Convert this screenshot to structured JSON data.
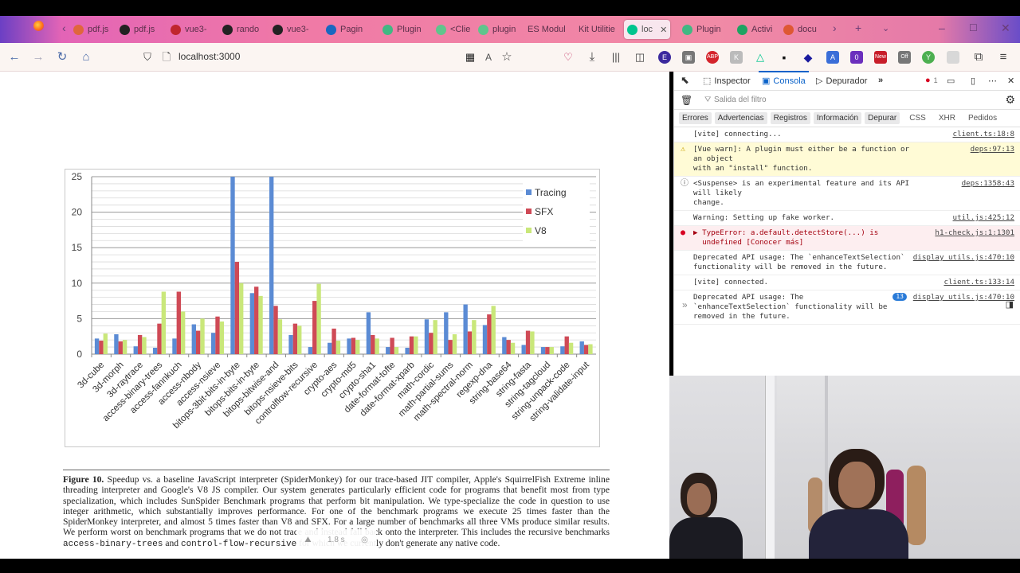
{
  "browser": {
    "tabs": [
      {
        "label": "pdf.js",
        "icon": "firefox-back-icon",
        "color": "#e0663c"
      },
      {
        "label": "pdf.js",
        "icon": "github-icon",
        "color": "#222"
      },
      {
        "label": "vue3-",
        "icon": "red-square-icon",
        "color": "#c0262d"
      },
      {
        "label": "rando",
        "icon": "github-icon",
        "color": "#222"
      },
      {
        "label": "vue3-",
        "icon": "github-icon",
        "color": "#222"
      },
      {
        "label": "Pagin",
        "icon": "vuetify-icon",
        "color": "#1867c0"
      },
      {
        "label": "Plugin",
        "icon": "vue-icon",
        "color": "#41b883"
      },
      {
        "label": "<Clie",
        "icon": "nuxt-icon",
        "color": "#5fc58c"
      },
      {
        "label": "plugin",
        "icon": "nuxt-icon",
        "color": "#5fc58c"
      },
      {
        "label": "ES Modul",
        "icon": "",
        "color": ""
      },
      {
        "label": "Kit Utilitie",
        "icon": "",
        "color": ""
      },
      {
        "label": "loc",
        "icon": "nuxt-icon",
        "color": "#00c58e",
        "active": true
      },
      {
        "label": "Plugin",
        "icon": "vue-icon",
        "color": "#41b883"
      },
      {
        "label": "Activi",
        "icon": "sheets-icon",
        "color": "#1ea362"
      },
      {
        "label": "docu",
        "icon": "duckduckgo-icon",
        "color": "#de5833"
      }
    ],
    "url": "localhost:3000",
    "extensions_badges": {
      "counter": "0",
      "new": "New",
      "off": "Off"
    }
  },
  "devtools": {
    "tabs": {
      "inspector": "Inspector",
      "console": "Consola",
      "debugger": "Depurador"
    },
    "error_count": "1",
    "filter_placeholder": "Salida del filtro",
    "levels": [
      "Errores",
      "Advertencias",
      "Registros",
      "Información",
      "Depurar"
    ],
    "levels_off": [
      "CSS",
      "XHR",
      "Pedidos"
    ],
    "messages": [
      {
        "type": "log",
        "text": "[vite] connecting...",
        "source": "client.ts:18:8"
      },
      {
        "type": "warn",
        "text": "[Vue warn]: A plugin must either be a function or an object\nwith an \"install\" function.",
        "source": "deps:97:13"
      },
      {
        "type": "info",
        "text": "<Suspense> is an experimental feature and its API will likely\nchange.",
        "source": "deps:1358:43"
      },
      {
        "type": "log",
        "text": "Warning: Setting up fake worker.",
        "source": "util.js:425:12"
      },
      {
        "type": "error",
        "text": "▶ TypeError: a.default.detectStore(...) is\n  undefined [Conocer más]",
        "source": "h1-check.js:1:1301"
      },
      {
        "type": "log",
        "text": "Deprecated API usage: The `enhanceTextSelection`\nfunctionality will be removed in the future.",
        "source": "display utils.js:470:10"
      },
      {
        "type": "log",
        "text": "[vite] connected.",
        "source": "client.ts:133:14"
      },
      {
        "type": "log",
        "text": "Deprecated API usage: The\n`enhanceTextSelection` functionality will be\nremoved in the future.",
        "source": "display utils.js:470:10",
        "repeat": "13"
      }
    ],
    "prompt": "»"
  },
  "pdf": {
    "caption_label": "Figure 10.",
    "caption_text": "Speedup vs. a baseline JavaScript interpreter (SpiderMonkey) for our trace-based JIT compiler, Apple's SquirrelFish Extreme inline threading interpreter and Google's V8 JS compiler. Our system generates particularly efficient code for programs that benefit most from type specialization, which includes SunSpider Benchmark programs that perform bit manipulation. We type-specialize the code in question to use integer arithmetic, which substantially improves performance. For one of the benchmark programs we execute 25 times faster than the SpiderMonkey interpreter, and almost 5 times faster than V8 and SFX. For a large number of benchmarks all three VMs produce similar results. We perform worst on benchmark programs that we do not trace and instead fall back onto the interpreter. This includes the recursive benchmarks",
    "caption_code1": "access-binary-trees",
    "caption_and": "and",
    "caption_code2": "control-flow-recursive",
    "caption_tail": "for which we currently don't generate any native code.",
    "overlay_time": "1.8 s"
  },
  "chart_data": {
    "type": "bar",
    "title": "",
    "xlabel": "",
    "ylabel": "",
    "ylim": [
      0,
      25
    ],
    "yticks": [
      0,
      5,
      10,
      15,
      20,
      25
    ],
    "grid": true,
    "legend": "top-right",
    "categories": [
      "3d-cube",
      "3d-morph",
      "3d-raytrace",
      "access-binary-trees",
      "access-fannkuch",
      "access-nbody",
      "access-nsieve",
      "bitops-3bit-bits-in-byte",
      "bitops-bits-in-byte",
      "bitops-bitwise-and",
      "bitops-nsieve-bits",
      "controlflow-recursive",
      "crypto-aes",
      "crypto-md5",
      "crypto-sha1",
      "date-format-tofte",
      "date-format-xparb",
      "math-cordic",
      "math-partial-sums",
      "math-spectral-norm",
      "regexp-dna",
      "string-base64",
      "string-fasta",
      "string-tagcloud",
      "string-unpack-code",
      "string-validate-input"
    ],
    "series": [
      {
        "name": "Tracing",
        "color": "#5b8bd4",
        "values": [
          2.2,
          2.8,
          1.1,
          0.9,
          2.2,
          4.2,
          3.0,
          25,
          8.6,
          25,
          2.7,
          1.0,
          1.6,
          2.2,
          5.9,
          1.0,
          0.9,
          4.9,
          5.9,
          7.0,
          4.1,
          2.4,
          1.3,
          1.0,
          1.1,
          1.8
        ]
      },
      {
        "name": "SFX",
        "color": "#cf4a56",
        "values": [
          1.9,
          1.8,
          2.7,
          4.3,
          8.8,
          3.3,
          5.3,
          13.0,
          9.5,
          6.8,
          4.3,
          7.5,
          3.6,
          2.3,
          2.7,
          2.3,
          2.5,
          3.0,
          2.0,
          3.2,
          5.6,
          2.0,
          3.3,
          1.0,
          2.5,
          1.3
        ]
      },
      {
        "name": "V8",
        "color": "#c9e77a",
        "values": [
          2.9,
          2.0,
          2.4,
          8.8,
          6.0,
          5.0,
          4.6,
          10.0,
          8.2,
          4.9,
          4.0,
          9.9,
          1.9,
          2.0,
          2.2,
          1.0,
          2.5,
          4.8,
          2.8,
          4.8,
          6.8,
          1.6,
          3.2,
          1.0,
          1.6,
          1.4
        ]
      }
    ]
  }
}
